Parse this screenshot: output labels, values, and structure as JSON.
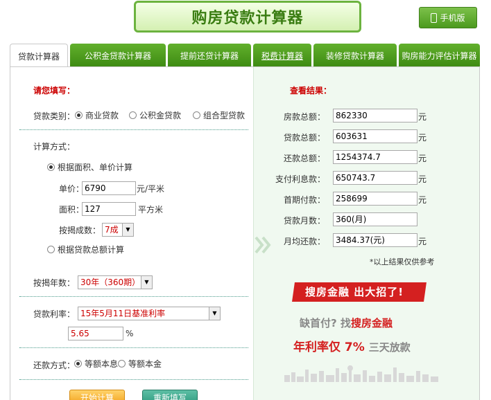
{
  "header": {
    "title": "购房贷款计算器",
    "mobile_button": "手机版"
  },
  "tabs": [
    {
      "label": "贷款计算器",
      "active": true
    },
    {
      "label": "公积金贷款计算器"
    },
    {
      "label": "提前还贷计算器"
    },
    {
      "label": "税费计算器"
    },
    {
      "label": "装修贷款计算器"
    },
    {
      "label": "购房能力评估计算器"
    }
  ],
  "form": {
    "heading": "请您填写：",
    "loan_type_label": "贷款类别：",
    "loan_types": [
      "商业贷款",
      "公积金贷款",
      "组合型贷款"
    ],
    "calc_method_label": "计算方式：",
    "method_area": "根据面积、单价计算",
    "unit_price_label": "单价：",
    "unit_price_value": "6790",
    "unit_price_unit": "元/平米",
    "area_label": "面积：",
    "area_value": "127",
    "area_unit": "平方米",
    "ratio_label": "按揭成数：",
    "ratio_value": "7成",
    "method_total": "根据贷款总额计算",
    "years_label": "按揭年数：",
    "years_value": "30年（360期）",
    "rate_label": "贷款利率：",
    "rate_value": "15年5月11日基准利率",
    "rate_input": "5.65",
    "rate_unit": "%",
    "repay_label": "还款方式：",
    "repay_options": [
      "等额本息",
      "等额本金"
    ],
    "start_button": "开始计算",
    "reset_button": "重新填写"
  },
  "results": {
    "heading": "查看结果：",
    "rows": [
      {
        "label": "房款总额：",
        "value": "862330",
        "unit": "元"
      },
      {
        "label": "贷款总额：",
        "value": "603631",
        "unit": "元"
      },
      {
        "label": "还款总额：",
        "value": "1254374.7",
        "unit": "元"
      },
      {
        "label": "支付利息款：",
        "value": "650743.7",
        "unit": "元"
      },
      {
        "label": "首期付款：",
        "value": "258699",
        "unit": "元"
      },
      {
        "label": "贷款月数：",
        "value": "360(月)",
        "unit": ""
      },
      {
        "label": "月均还款：",
        "value": "3484.37(元)",
        "unit": "元"
      }
    ],
    "note": "*以上结果仅供参考"
  },
  "promo": {
    "banner": "搜房金融  出大招了!",
    "line1_a": "缺首付",
    "line1_q": "?",
    "line1_b": "找",
    "line1_c": "搜房金融",
    "line2_a": "年利率仅 7%",
    "line2_b": "三天放款"
  }
}
